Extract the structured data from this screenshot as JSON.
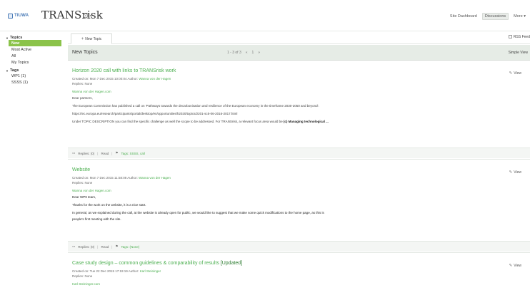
{
  "header": {
    "logo_text": "TIUWA",
    "app_title": "TRANSrisk",
    "links": [
      "Site Dashboard",
      "Discussions",
      "More"
    ]
  },
  "sidebar": {
    "topics_heading": "Topics",
    "topics": [
      {
        "label": "New",
        "active": true
      },
      {
        "label": "Most Active",
        "active": false
      },
      {
        "label": "All",
        "active": false
      },
      {
        "label": "My Topics",
        "active": false
      }
    ],
    "tags_heading": "Tags",
    "tags": [
      {
        "label": "WP1 (1)"
      },
      {
        "label": "SSSS (1)"
      }
    ]
  },
  "toolbar": {
    "new_topic_label": "New Topic",
    "subscribe_label": "RSS Feed"
  },
  "list": {
    "title": "New Topics",
    "pager_text": "1 - 3 of 3",
    "pager_prev": "«",
    "pager_page": "1",
    "pager_next": "»",
    "view_mode": "Simple View"
  },
  "posts": [
    {
      "title": "Horizon 2020 call with links to TRANSrisk work",
      "meta_created": "Created on: Mon 7 Dec 2015 10:00:04 Author:",
      "meta_author": "Wanna von der Hagen",
      "meta_replies": "Replies: None",
      "lines": [
        {
          "text": "Wanna von der Hagen.com",
          "cls": "lnk"
        },
        {
          "text": "Dear partners,",
          "cls": ""
        },
        {
          "text": "The European Commission has published a call on 'Pathways towards the decarbonisation and resilience of the European economy in the timeframe 2030-2050 and beyond'.",
          "cls": ""
        },
        {
          "text": "https://ec.europa.eu/research/participants/portal/desktop/en/opportunities/h2020/topics/2201-sc5-06-2016-2017.html",
          "cls": ""
        },
        {
          "text": "Under TOPIC DESCRIPTION you can find the specific challenge as well the scope to be addressed. For TRANSrisk, a relevant focus area would be",
          "bold": "(c) Managing technological ..."
        }
      ],
      "view_label": "View",
      "replies": "Replies: (0)",
      "read": "Read",
      "tags": "Tags: SSSS, call"
    },
    {
      "title": "Website",
      "meta_created": "Created on: Mon 7 Dec 2015 11:58:08 Author:",
      "meta_author": "Wanna von der Hagen",
      "meta_replies": "Replies: None",
      "lines": [
        {
          "text": "Wanna von der Hagen.com",
          "cls": "lnk"
        },
        {
          "text": "Dear WP9 team,",
          "cls": "strong"
        },
        {
          "text": "Thanks for the work on the website, it is a nice start.",
          "cls": "strong"
        },
        {
          "text": "In general, as we explained during the call, at the website is already open for public, we would like to suggest that we make some quick modifications to the home page, as this is",
          "cls": "strong"
        },
        {
          "text": "people's first meeting with the site.",
          "cls": "strong"
        }
      ],
      "view_label": "View",
      "replies": "Replies: (0)",
      "read": "Read",
      "tags": "Tags: (None)"
    },
    {
      "title": "Case study design – common guidelines & comparability of results",
      "title_suffix": "[Updated]",
      "meta_created": "Created on: Tue 22 Dec 2015 17:19:19 Author:",
      "meta_author": "Karl Steininger",
      "meta_replies": "Replies: None",
      "lines": [
        {
          "text": "Karl Steininger.com",
          "cls": "lnk"
        }
      ],
      "view_label": "View"
    }
  ]
}
